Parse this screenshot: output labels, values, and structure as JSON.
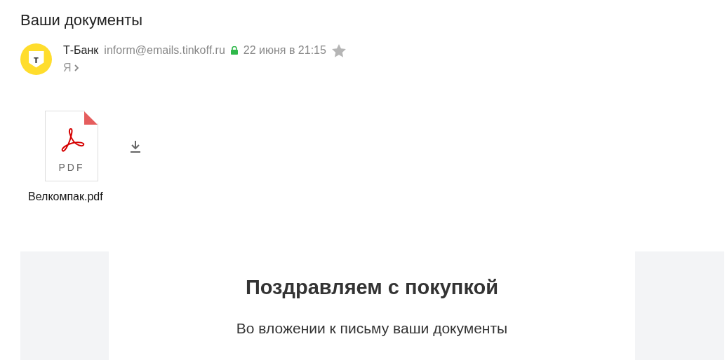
{
  "subject": "Ваши документы",
  "sender": {
    "logo_letter": "т",
    "name": "Т-Банк",
    "email": "inform@emails.tinkoff.ru",
    "secure": true,
    "date": "22 июня в 21:15",
    "starred": false,
    "recipient": "Я"
  },
  "attachments": [
    {
      "type_label": "PDF",
      "filename": "Велкомпак.pdf"
    }
  ],
  "body": {
    "heading": "Поздравляем с покупкой",
    "text": "Во вложении к письму ваши документы"
  }
}
